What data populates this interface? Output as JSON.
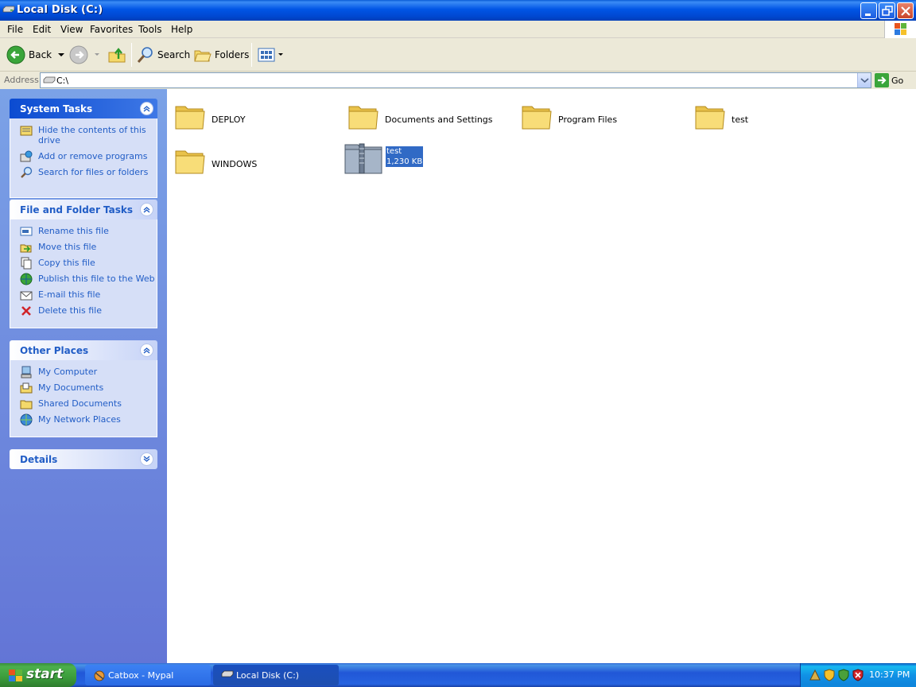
{
  "window": {
    "title": "Local Disk (C:)"
  },
  "menu": [
    "File",
    "Edit",
    "View",
    "Favorites",
    "Tools",
    "Help"
  ],
  "toolbar": {
    "back": "Back",
    "search": "Search",
    "folders": "Folders"
  },
  "address": {
    "label": "Address",
    "value": "C:\\",
    "go": "Go"
  },
  "tasks": {
    "system": {
      "title": "System Tasks",
      "items": [
        "Hide the contents of this drive",
        "Add or remove programs",
        "Search for files or folders"
      ]
    },
    "file_folder": {
      "title": "File and Folder Tasks",
      "items": [
        "Rename this file",
        "Move this file",
        "Copy this file",
        "Publish this file to the Web",
        "E-mail this file",
        "Delete this file"
      ]
    },
    "other": {
      "title": "Other Places",
      "items": [
        "My Computer",
        "My Documents",
        "Shared Documents",
        "My Network Places"
      ]
    },
    "details": {
      "title": "Details"
    }
  },
  "files": {
    "folders": [
      "DEPLOY",
      "Documents and Settings",
      "Program Files",
      "test",
      "WINDOWS"
    ],
    "selected": {
      "name": "test",
      "size": "1,230 KB"
    }
  },
  "taskbar": {
    "start": "start",
    "buttons": [
      "Catbox - Mypal",
      "Local Disk (C:)"
    ],
    "clock": "10:37 PM"
  },
  "colors": {
    "title_blue": "#0055e5",
    "pane_blue": "#6375d6",
    "link_blue": "#215dc6",
    "selection": "#316ac5",
    "folder_yellow": "#f4d96b"
  }
}
